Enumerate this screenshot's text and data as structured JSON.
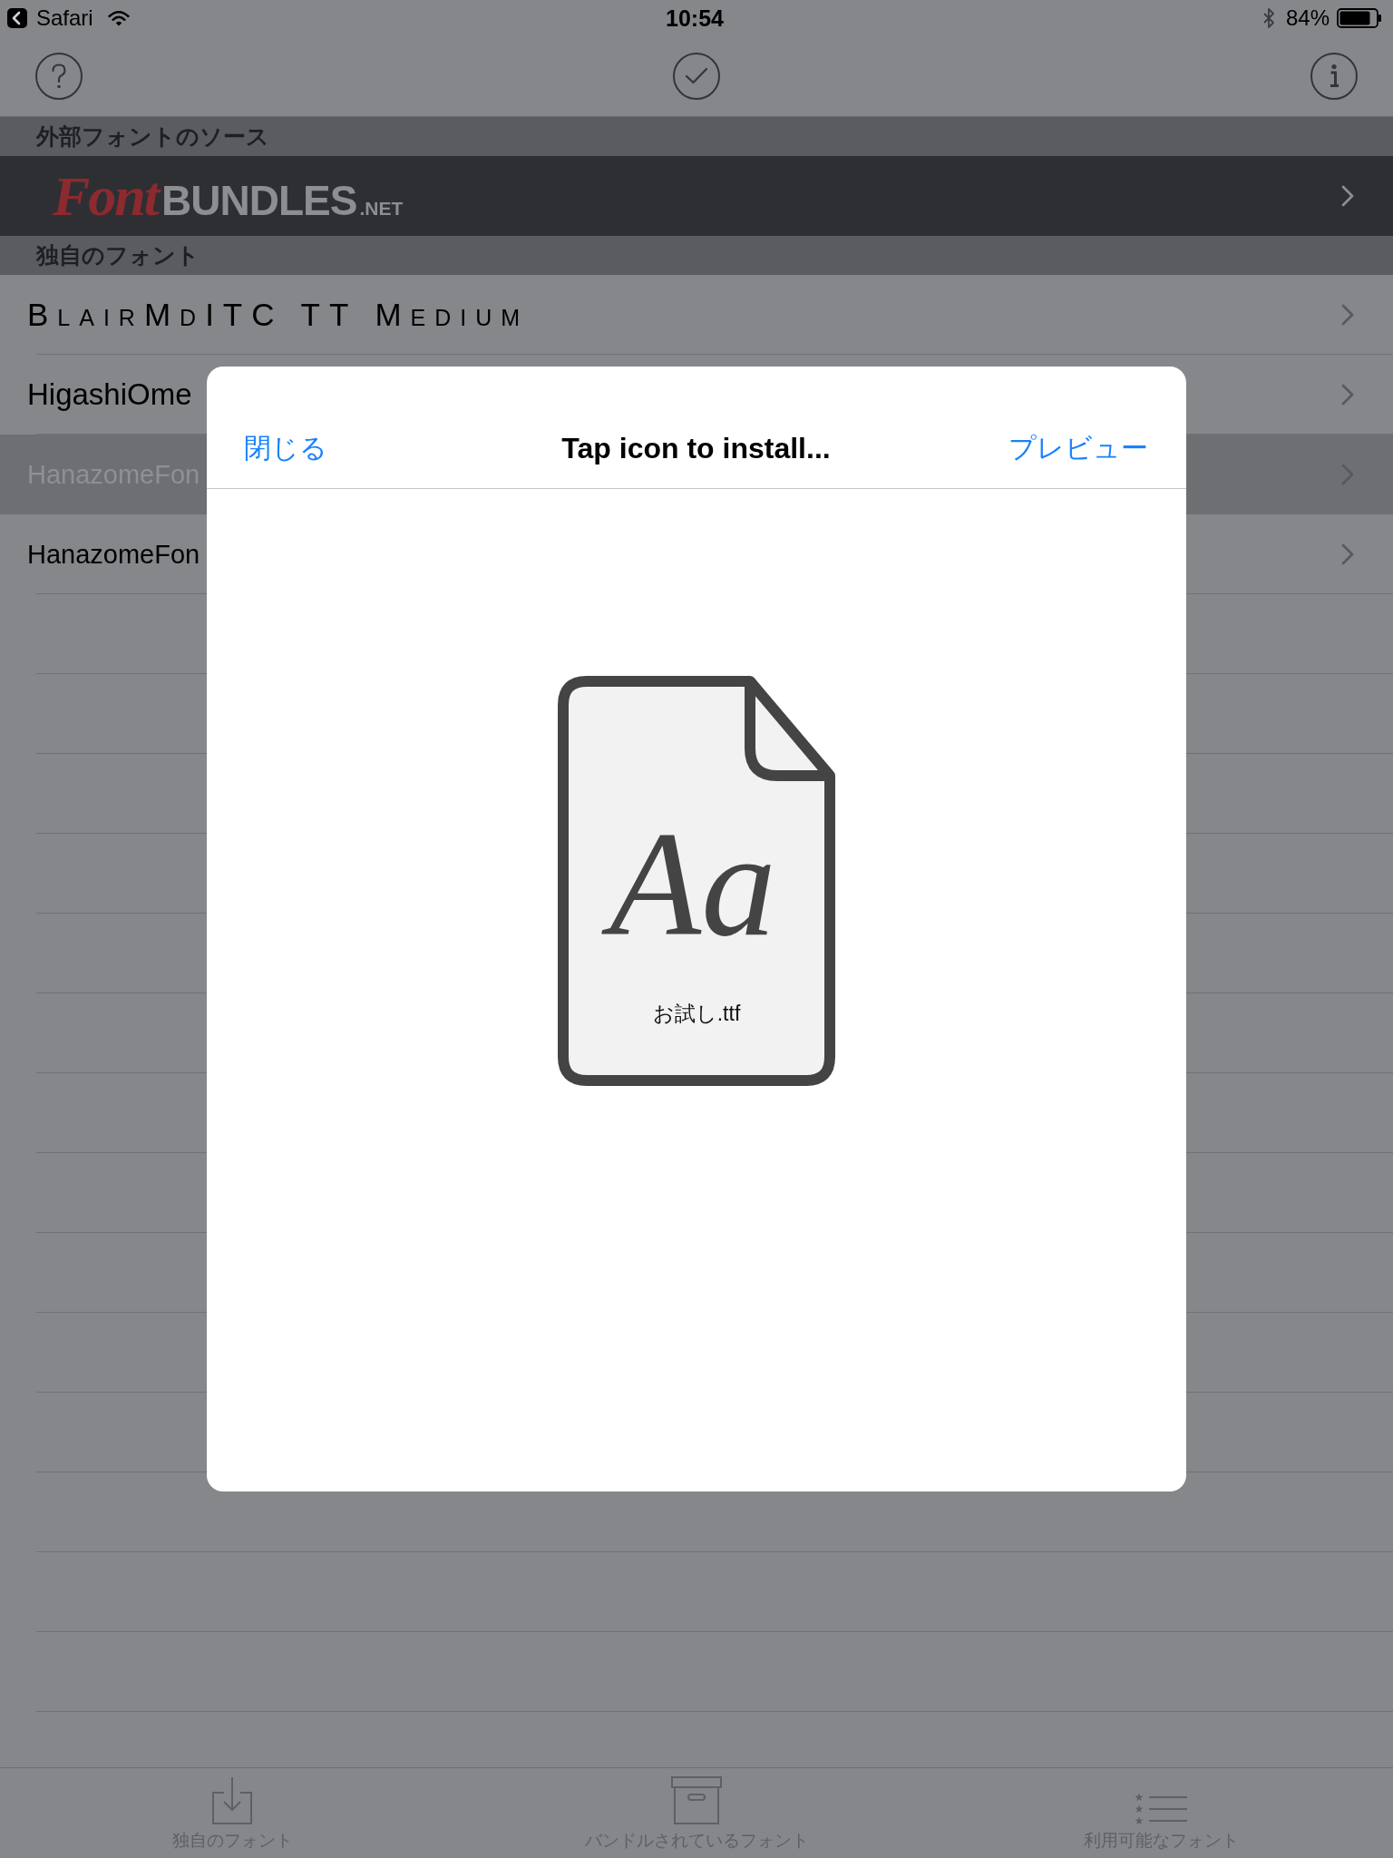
{
  "status_bar": {
    "back_label": "Safari",
    "time": "10:54",
    "battery": "84%"
  },
  "sections": [
    {
      "header": "外部フォントのソース",
      "rows": [
        {
          "kind": "logo",
          "logo_script": "Font",
          "logo_word": "BUNDLES",
          "logo_suffix": ".NET"
        }
      ]
    },
    {
      "header": "独自のフォント",
      "rows": [
        {
          "kind": "font",
          "label": "BlairMdITC TT Medium",
          "selected": false
        },
        {
          "kind": "font",
          "label": "HigashiOme",
          "selected": false
        },
        {
          "kind": "font",
          "label": "HanazomeFon",
          "selected": true
        },
        {
          "kind": "font",
          "label": "HanazomeFon",
          "selected": false
        }
      ]
    }
  ],
  "dialog": {
    "close": "閉じる",
    "title": "Tap icon to install...",
    "preview": "プレビュー",
    "file": {
      "sample": "Aa",
      "name": "お試し.ttf"
    }
  },
  "tab_bar": [
    {
      "label": "独自のフォント",
      "selected": false
    },
    {
      "label": "バンドルされているフォント",
      "selected": false
    },
    {
      "label": "利用可能なフォント",
      "selected": false
    }
  ]
}
